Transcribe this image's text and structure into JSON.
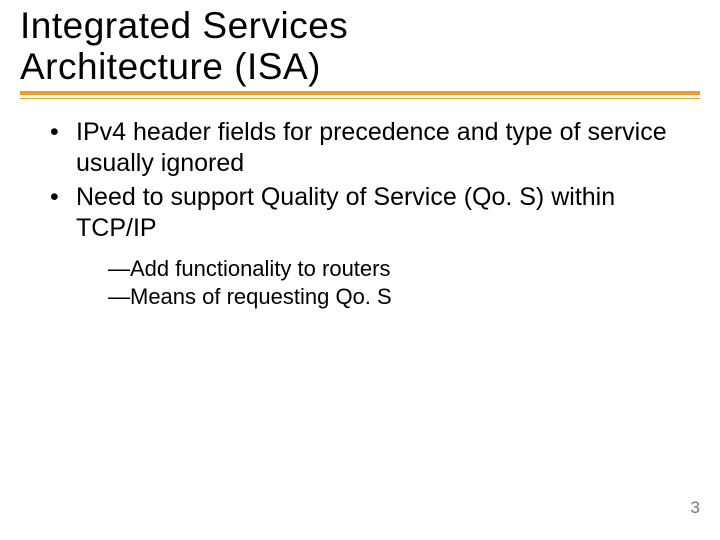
{
  "title_line1": "Integrated Services",
  "title_line2": "Architecture (ISA)",
  "bullets": [
    "IPv4 header fields for precedence and type of service usually ignored",
    "Need to support Quality of Service (Qo. S) within TCP/IP"
  ],
  "sub_dash": "—",
  "subbullets": [
    "Add functionality to routers",
    "Means of requesting Qo. S"
  ],
  "page_number": "3"
}
